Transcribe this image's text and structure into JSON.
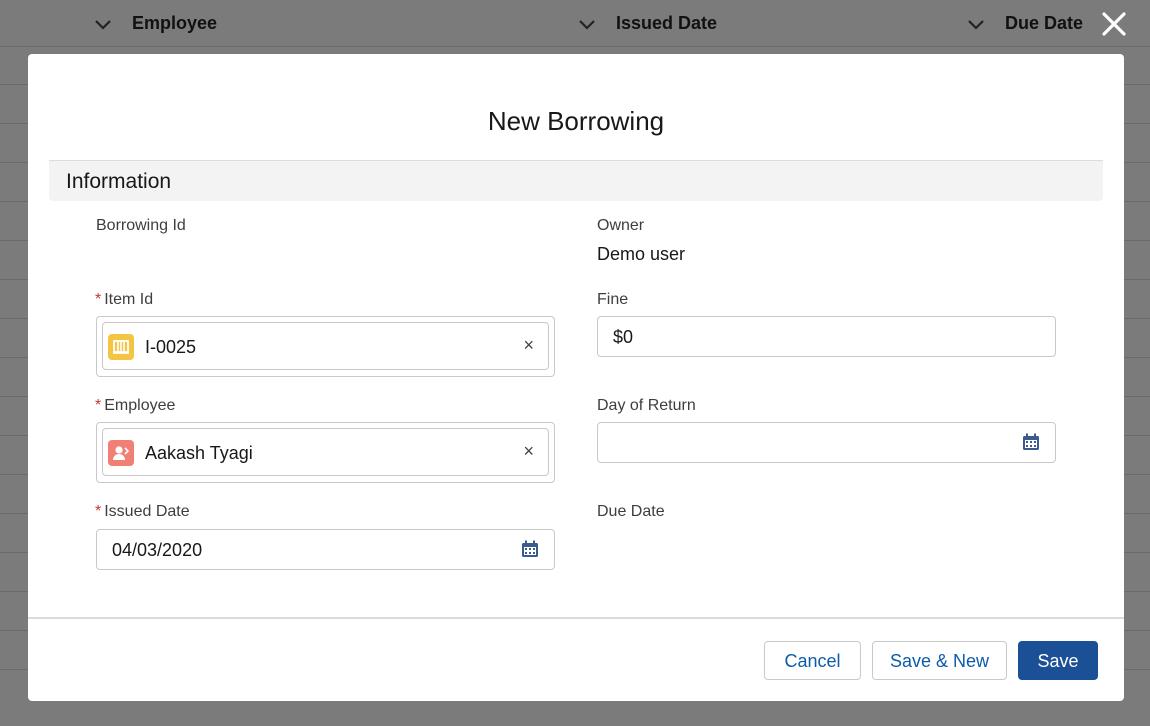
{
  "background": {
    "columns": [
      {
        "label": "Employee"
      },
      {
        "label": "Issued Date"
      },
      {
        "label": "Due Date"
      }
    ],
    "close_icon": "close-icon"
  },
  "modal": {
    "title": "New Borrowing",
    "section_title": "Information",
    "fields": {
      "borrowing_id": {
        "label": "Borrowing Id"
      },
      "owner": {
        "label": "Owner",
        "value": "Demo user"
      },
      "item_id": {
        "label": "Item Id",
        "required_mark": "*",
        "value": "I-0025",
        "icon": "item-object-icon",
        "remove": "×"
      },
      "fine": {
        "label": "Fine",
        "value": "$0"
      },
      "employee": {
        "label": "Employee",
        "required_mark": "*",
        "value": "Aakash Tyagi",
        "icon": "contact-object-icon",
        "remove": "×"
      },
      "day_of_return": {
        "label": "Day of Return",
        "value": ""
      },
      "issued_date": {
        "label": "Issued Date",
        "required_mark": "*",
        "value": "04/03/2020"
      },
      "due_date": {
        "label": "Due Date"
      }
    },
    "buttons": {
      "cancel": "Cancel",
      "save_new": "Save & New",
      "save": "Save"
    }
  },
  "colors": {
    "brand": "#1b4f96",
    "required": "#c23934",
    "item_icon_bg": "#f4c443",
    "employee_icon_bg": "#f07f75"
  }
}
